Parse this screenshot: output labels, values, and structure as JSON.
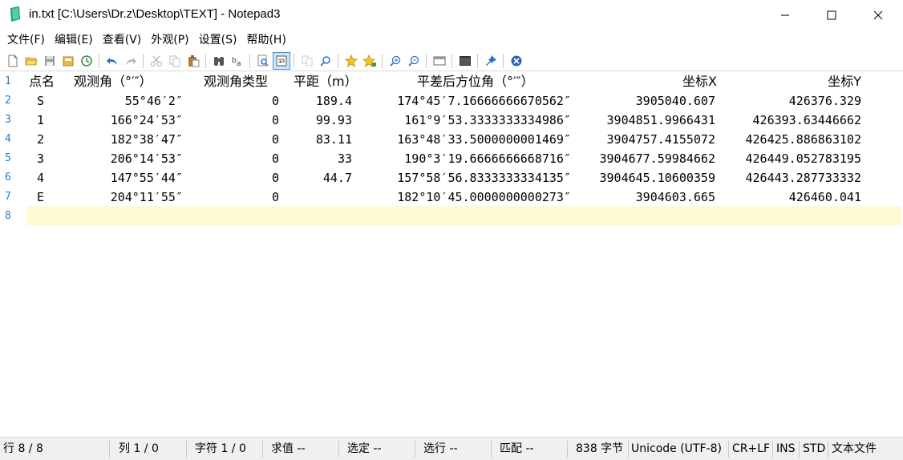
{
  "window": {
    "title": "in.txt [C:\\Users\\Dr.z\\Desktop\\TEXT] - Notepad3"
  },
  "menu": [
    "文件(F)",
    "编辑(E)",
    "查看(V)",
    "外观(P)",
    "设置(S)",
    "帮助(H)"
  ],
  "toolbar": {
    "buttons": [
      "new-file",
      "open-file",
      "save",
      "save-as",
      "reload",
      "undo",
      "redo",
      "cut",
      "copy",
      "paste",
      "find",
      "replace",
      "find-in-files",
      "word-wrap",
      "select-all",
      "zoom-page",
      "favorites",
      "add-favorite",
      "zoom-in",
      "zoom-out",
      "view-options",
      "console",
      "pin",
      "close"
    ]
  },
  "editor": {
    "line_numbers": [
      "1",
      "2",
      "3",
      "4",
      "5",
      "6",
      "7",
      "8"
    ],
    "header": {
      "name": "点名",
      "angle": "观测角（°′″）",
      "angle_type": "观测角类型",
      "distance": "平距（m）",
      "azimuth": "平差后方位角（°′″）",
      "x": "坐标X",
      "y": "坐标Y"
    },
    "rows": [
      {
        "name": "S",
        "angle": "55°46′2″",
        "type": "0",
        "dist": "189.4",
        "azimuth": "174°45′7.16666666670562″",
        "x": "3905040.607",
        "y": "426376.329"
      },
      {
        "name": "1",
        "angle": "166°24′53″",
        "type": "0",
        "dist": "99.93",
        "azimuth": "161°9′53.3333333334986″",
        "x": "3904851.9966431",
        "y": "426393.63446662"
      },
      {
        "name": "2",
        "angle": "182°38′47″",
        "type": "0",
        "dist": "83.11",
        "azimuth": "163°48′33.5000000001469″",
        "x": "3904757.4155072",
        "y": "426425.886863102"
      },
      {
        "name": "3",
        "angle": "206°14′53″",
        "type": "0",
        "dist": "33",
        "azimuth": "190°3′19.6666666668716″",
        "x": "3904677.59984662",
        "y": "426449.052783195"
      },
      {
        "name": "4",
        "angle": "147°55′44″",
        "type": "0",
        "dist": "44.7",
        "azimuth": "157°58′56.8333333334135″",
        "x": "3904645.10600359",
        "y": "426443.287733332"
      },
      {
        "name": "E",
        "angle": "204°11′55″",
        "type": "0",
        "dist": "",
        "azimuth": "182°10′45.0000000000273″",
        "x": "3904603.665",
        "y": "426460.041"
      }
    ]
  },
  "status": {
    "line": "行 8 / 8",
    "col": "列 1 / 0",
    "char": "字符 1 / 0",
    "value": "求值 --",
    "selected": "选定 --",
    "selected_lines": "选行 --",
    "match": "匹配 --",
    "size": "838 字节",
    "encoding": "Unicode (UTF-8)",
    "eol": "CR+LF",
    "ins": "INS",
    "std": "STD",
    "filetype": "文本文件"
  },
  "colors": {
    "current_line_bg": "#fdfbd2",
    "line_number": "#2b7bb9",
    "statusbar_bg": "#f0f0f0"
  }
}
